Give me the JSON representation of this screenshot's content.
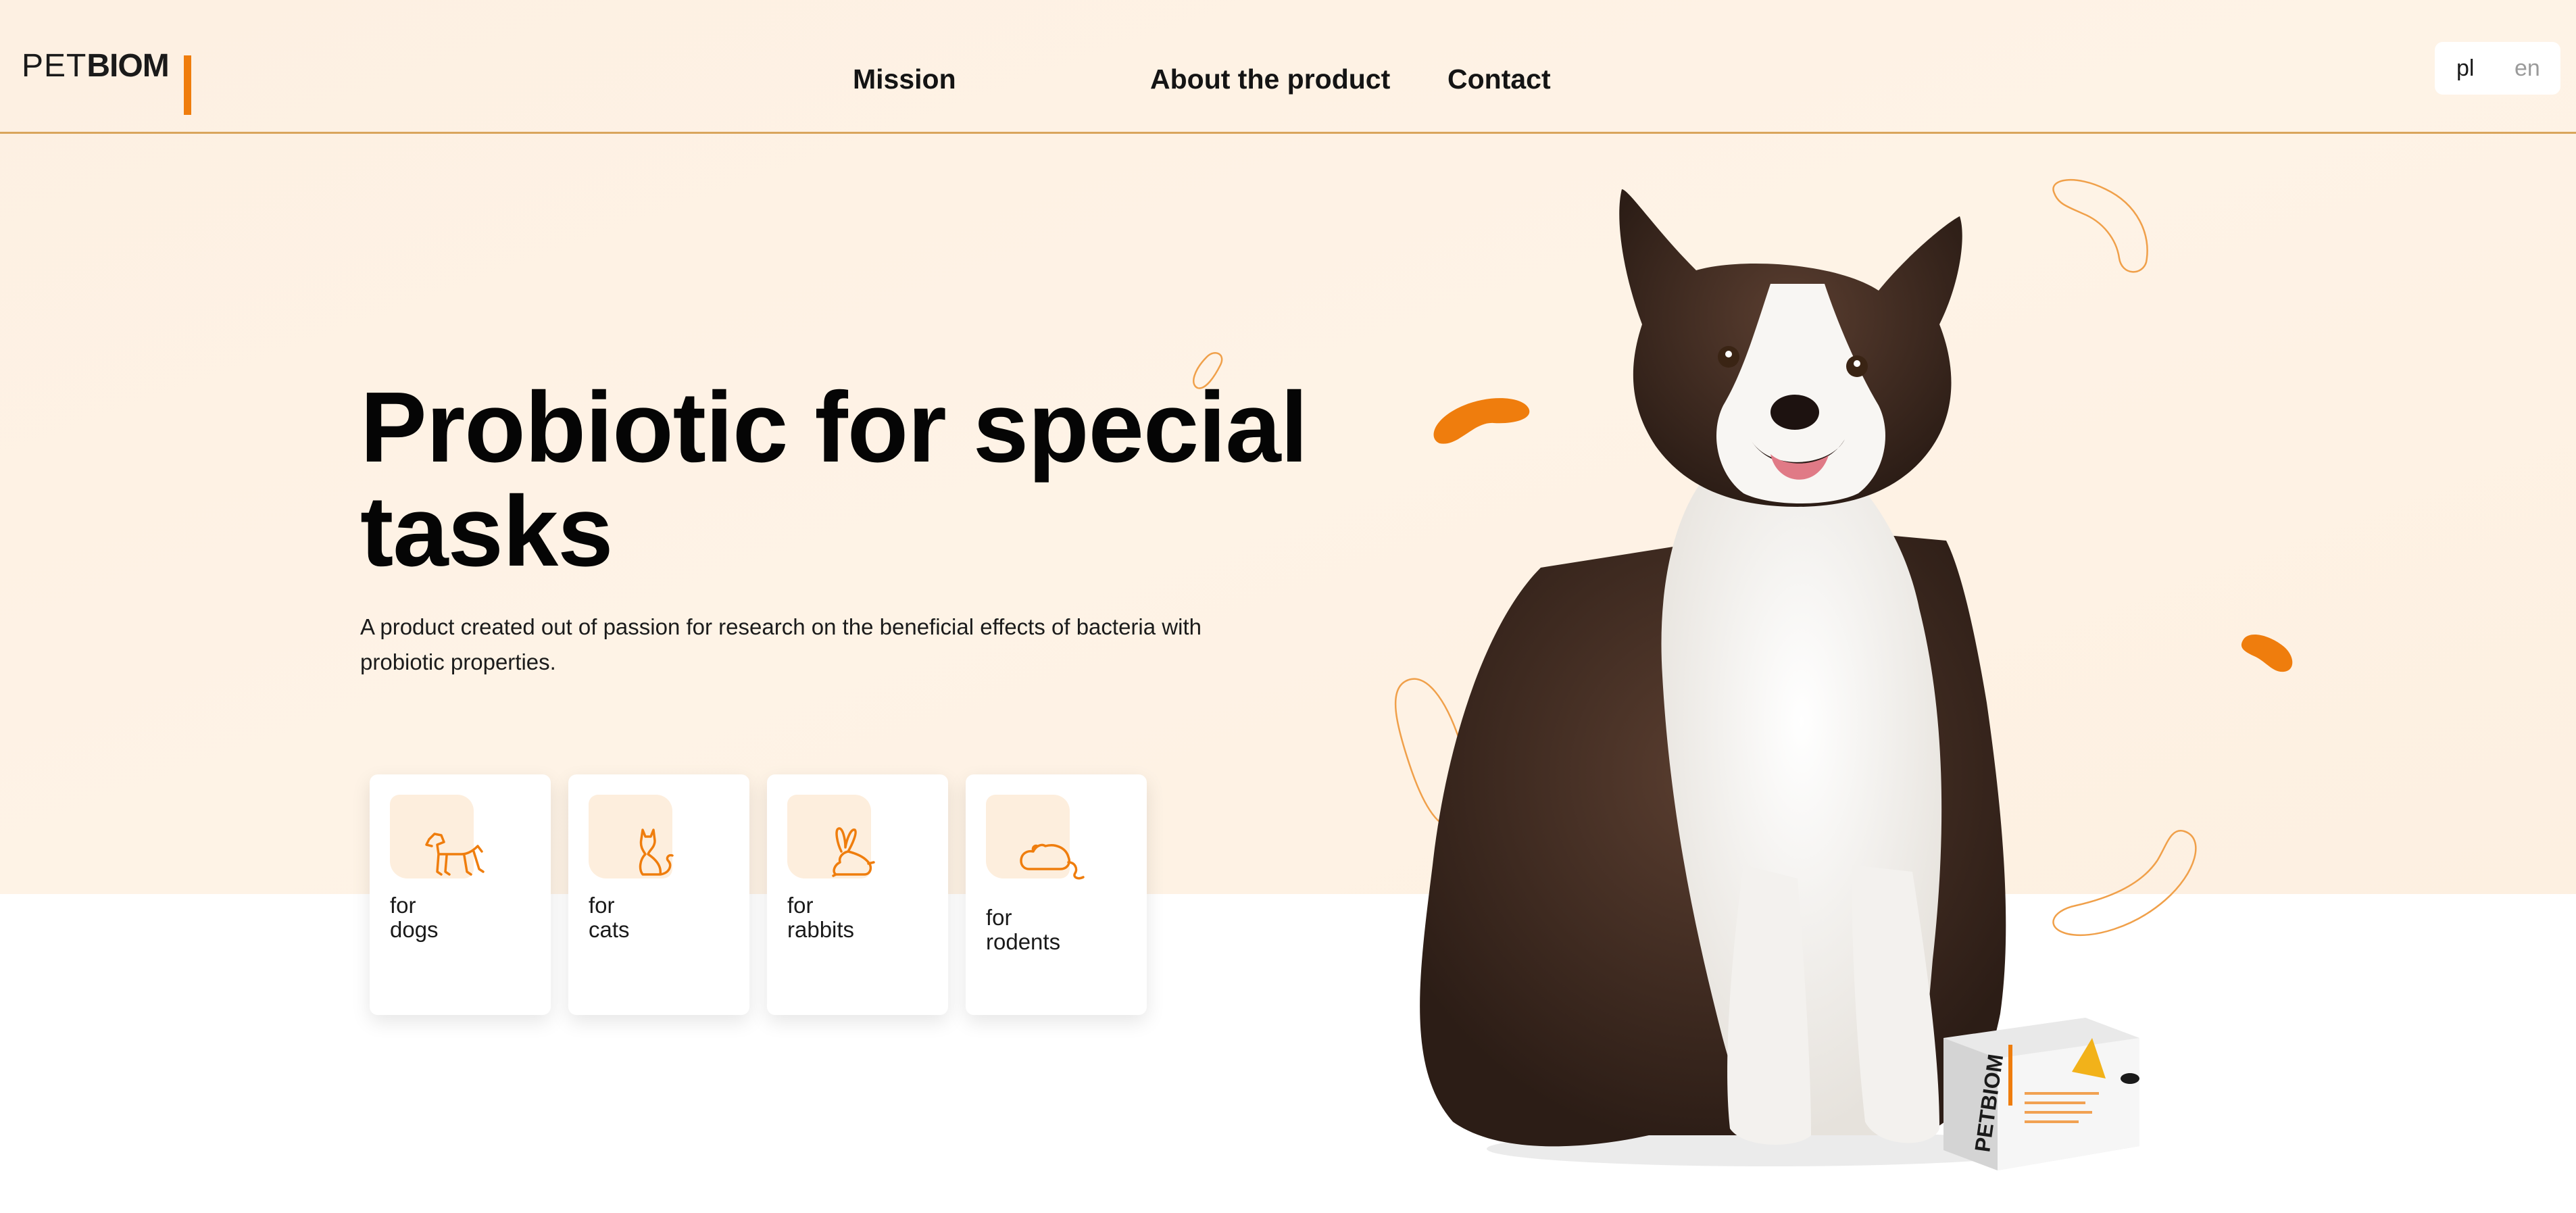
{
  "header": {
    "logo": {
      "pet": "PET",
      "biom": "BIOM"
    },
    "nav": [
      {
        "label": "Mission"
      },
      {
        "label": "About the product"
      },
      {
        "label": "Contact"
      }
    ],
    "languages": [
      {
        "code": "pl",
        "active": true
      },
      {
        "code": "en",
        "active": false
      }
    ]
  },
  "hero": {
    "title": "Probiotic for special tasks",
    "description": "A product created out of passion for research on the beneficial effects of bacteria with probiotic properties."
  },
  "categories": [
    {
      "line1": "for",
      "line2": "dogs",
      "icon": "dog-icon"
    },
    {
      "line1": "for",
      "line2": "cats",
      "icon": "cat-icon"
    },
    {
      "line1": "for",
      "line2": "rabbits",
      "icon": "rabbit-icon"
    },
    {
      "line1": "for",
      "line2": "rodents",
      "icon": "rodent-icon"
    }
  ],
  "colors": {
    "accent": "#ef7d0d",
    "hero_background": "#fdf0e2",
    "header_border": "#d9a55c",
    "text": "#111111"
  },
  "images": {
    "hero_dog": "border-collie-photo",
    "product_box": "petbiom-product-box"
  }
}
